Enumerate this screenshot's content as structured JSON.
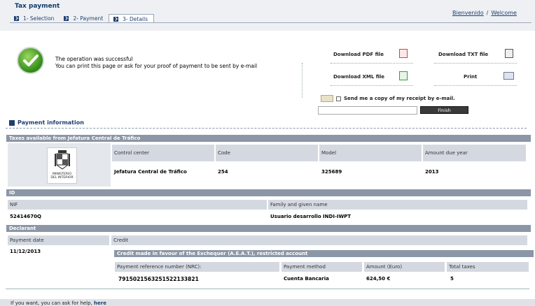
{
  "header": {
    "app_title": "Tax payment",
    "tabs": [
      {
        "label": "1- Selection"
      },
      {
        "label": "2- Payment"
      },
      {
        "label": "3- Details"
      }
    ],
    "links": {
      "bienvenido": "Bienvenido",
      "separator": "/",
      "welcome": "Welcome"
    }
  },
  "success": {
    "line1": "The operation was successful",
    "line2": "You can print this page or ask for your proof of payment to be sent by e-mail"
  },
  "downloads": {
    "pdf": "Download PDF file",
    "txt": "Download TXT file",
    "xml": "Download XML file",
    "print": "Print"
  },
  "email": {
    "checkbox_label": "Send me a copy of my receipt by e-mail.",
    "input_value": "",
    "finish_label": "Finish"
  },
  "payment_info": {
    "title": "Payment information",
    "taxes_band": "Taxes available from Jefatura Central de Tráfico",
    "logo_text_1": "MINISTERIO",
    "logo_text_2": "DEL INTERIOR",
    "headers": {
      "control_center": "Control center",
      "code": "Code",
      "model": "Model",
      "amount_due_year": "Amount due year"
    },
    "values": {
      "control_center": "Jefatura Central de Tráfico",
      "code": "254",
      "model": "325689",
      "amount_due_year": "2013"
    }
  },
  "id_section": {
    "band": "ID",
    "nif_label": "NIF",
    "nif_value": "52414670Q",
    "name_label": "Family and given name",
    "name_value": "Usuario desarrollo INDI-IWPT"
  },
  "declarant": {
    "band": "Declarant",
    "payment_date_label": "Payment date",
    "payment_date_value": "11/12/2013",
    "credit_label": "Credit",
    "credit_band": "Credit made in favour of the Exchequer (A.E.A.T.), restricted account",
    "nrc_label": "Payment reference number (NRC):",
    "nrc_value": "7915021563251522133821",
    "method_label": "Payment method",
    "method_value": "Cuenta Bancaria",
    "amount_label": "Amount (Euro)",
    "amount_value": "624,50 €",
    "total_taxes_label": "Total taxes",
    "total_taxes_value": "5"
  },
  "footer": {
    "help_text": "If you want, you can ask for help,",
    "help_link": "here"
  }
}
